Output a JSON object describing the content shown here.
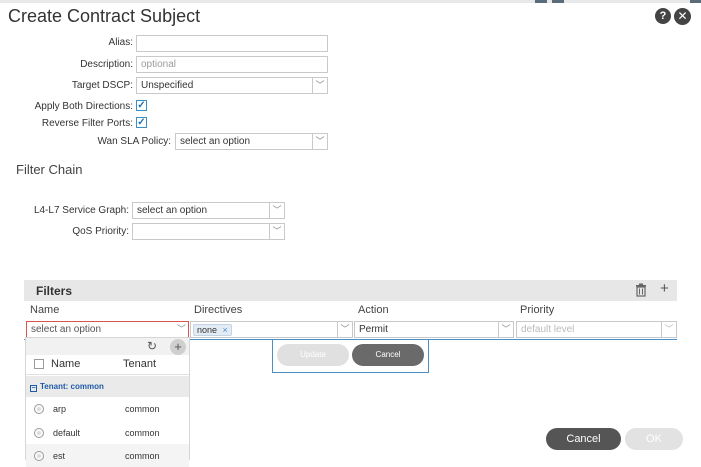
{
  "dialog": {
    "title": "Create Contract Subject",
    "help_label": "?",
    "close_label": "✕"
  },
  "form": {
    "alias_label": "Alias:",
    "alias_value": "",
    "description_label": "Description:",
    "description_placeholder": "optional",
    "target_dscp_label": "Target DSCP:",
    "target_dscp_value": "Unspecified",
    "apply_both_label": "Apply Both Directions:",
    "apply_both_checked": true,
    "reverse_filter_label": "Reverse Filter Ports:",
    "reverse_filter_checked": true,
    "wan_sla_label": "Wan SLA Policy:",
    "wan_sla_value": "select an option"
  },
  "filter_chain": {
    "heading": "Filter Chain",
    "l4l7_label": "L4-L7 Service Graph:",
    "l4l7_value": "select an option",
    "qos_label": "QoS Priority:",
    "qos_value": ""
  },
  "filters": {
    "heading": "Filters",
    "columns": [
      "Name",
      "Directives",
      "Action",
      "Priority"
    ],
    "row": {
      "name_placeholder": "select an option",
      "directive_chip": "none",
      "action_value": "Permit",
      "priority_placeholder": "default level"
    },
    "update_label": "Update",
    "cancel_label": "Cancel"
  },
  "dropdown": {
    "col_name": "Name",
    "col_tenant": "Tenant",
    "group": "Tenant: common",
    "items": [
      {
        "name": "arp",
        "tenant": "common"
      },
      {
        "name": "default",
        "tenant": "common"
      },
      {
        "name": "est",
        "tenant": "common"
      }
    ]
  },
  "footer": {
    "cancel_label": "Cancel",
    "ok_label": "OK"
  },
  "colors": {
    "accent_blue": "#4a8ec8",
    "error_red": "#d9534f",
    "dark_button": "#555555"
  }
}
